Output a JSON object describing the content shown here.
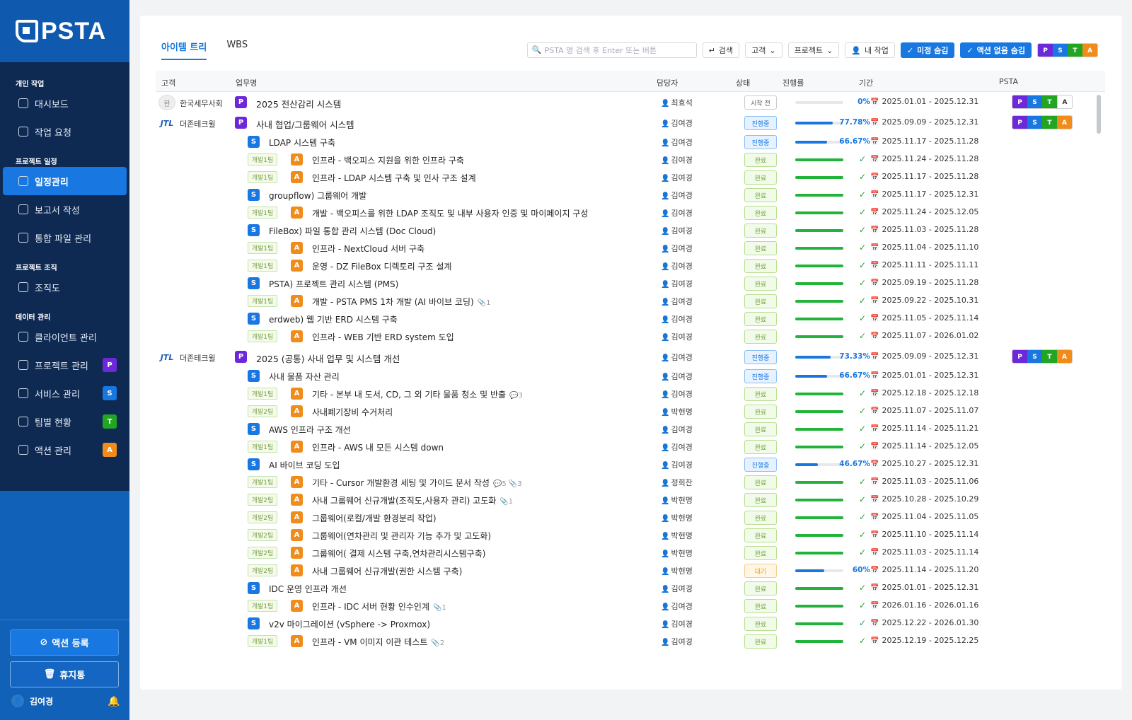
{
  "app": {
    "logo_text": "PSTA"
  },
  "sidebar": {
    "sections": [
      {
        "title": "개인 작업",
        "items": [
          {
            "label": "대시보드",
            "icon": "dashboard-icon"
          },
          {
            "label": "작업 요청",
            "icon": "edit-icon"
          }
        ]
      },
      {
        "title": "프로젝트 일정",
        "items": [
          {
            "label": "일정관리",
            "icon": "calendar-icon",
            "active": true
          },
          {
            "label": "보고서 작성",
            "icon": "document-icon"
          },
          {
            "label": "통합 파일 관리",
            "icon": "file-search-icon"
          }
        ]
      },
      {
        "title": "프로젝트 조직",
        "items": [
          {
            "label": "조직도",
            "icon": "org-chart-icon"
          }
        ]
      },
      {
        "title": "데이터 관리",
        "items": [
          {
            "label": "클라이언트 관리",
            "icon": "building-icon"
          },
          {
            "label": "프로젝트 관리",
            "icon": "folder-icon",
            "badge": "P"
          },
          {
            "label": "서비스 관리",
            "icon": "grid-icon",
            "badge": "S"
          },
          {
            "label": "팀별 현황",
            "icon": "team-icon",
            "badge": "T"
          },
          {
            "label": "액션 관리",
            "icon": "check-circle-icon",
            "badge": "A"
          }
        ]
      }
    ],
    "action_button": "액션 등록",
    "trash_button": "휴지통",
    "user_name": "김여경"
  },
  "colors": {
    "P": "#6d28d9",
    "S": "#1877e0",
    "T": "#22a522",
    "A": "#f08c1b",
    "accent": "#1877e0"
  },
  "tabs": [
    "아이템 트리",
    "WBS"
  ],
  "toolbar": {
    "search_placeholder": "PSTA 명 검색 후 Enter 또는 버튼",
    "search_button": "검색",
    "customer_select": "고객",
    "project_select": "프로젝트",
    "my_work": "내 작업",
    "hide_unfinished": "미정 숨김",
    "hide_no_action": "액션 없음 숨김",
    "psta_letters": [
      "P",
      "S",
      "T",
      "A"
    ]
  },
  "table": {
    "headers": [
      "고객",
      "업무명",
      "담당자",
      "상태",
      "진행률",
      "기간",
      "PSTA"
    ],
    "rows": [
      {
        "level": "P",
        "customer": "한국세무사회",
        "avatar": "한",
        "name": "2025 전산감리 시스템",
        "owner": "최효석",
        "status": "시작 전",
        "progress": 0,
        "progress_text": "0%",
        "period": "2025.01.01 - 2025.12.31",
        "psta": [
          "P",
          "S",
          "T",
          "A"
        ],
        "psta_on": 2
      },
      {
        "level": "P",
        "customer": "더존테크윌",
        "avatar": "JTL",
        "name": "사내 협업/그룹웨어 시스템",
        "owner": "김여경",
        "status": "진행중",
        "progress": 77.78,
        "progress_text": "77.78%",
        "period": "2025.09.09 - 2025.12.31",
        "psta": [
          "P",
          "S",
          "T",
          "A"
        ],
        "psta_on": 3
      },
      {
        "level": "S",
        "name": "LDAP 시스템 구축",
        "owner": "김여경",
        "status": "진행중",
        "progress": 66.67,
        "progress_text": "66.67%",
        "period": "2025.11.17 - 2025.11.28"
      },
      {
        "level": "A",
        "dev": "개발1팀",
        "name": "인프라 - 백오피스 지원을 위한 인프라 구축",
        "owner": "김여경",
        "status": "완료",
        "progress": 100,
        "period": "2025.11.24 - 2025.11.28"
      },
      {
        "level": "A",
        "dev": "개발1팀",
        "name": "인프라 - LDAP 시스템 구축 및 인사 구조 설계",
        "owner": "김여경",
        "status": "완료",
        "progress": 100,
        "period": "2025.11.17 - 2025.11.28"
      },
      {
        "level": "S",
        "name": "groupflow) 그룹웨어 개발",
        "owner": "김여경",
        "status": "완료",
        "progress": 100,
        "period": "2025.11.17 - 2025.12.31"
      },
      {
        "level": "A",
        "dev": "개발1팀",
        "name": "개발 - 백오피스를 위한 LDAP 조직도 및 내부 사용자 인증 및 마이페이지 구성",
        "owner": "김여경",
        "status": "완료",
        "progress": 100,
        "period": "2025.11.24 - 2025.12.05"
      },
      {
        "level": "S",
        "name": "FileBox) 파일 통합 관리 시스템 (Doc Cloud)",
        "owner": "김여경",
        "status": "완료",
        "progress": 100,
        "period": "2025.11.03 - 2025.11.28"
      },
      {
        "level": "A",
        "dev": "개발1팀",
        "name": "인프라 - NextCloud 서버 구축",
        "owner": "김여경",
        "status": "완료",
        "progress": 100,
        "period": "2025.11.04 - 2025.11.10"
      },
      {
        "level": "A",
        "dev": "개발1팀",
        "name": "운영 - DZ FileBox 디렉토리 구조 설계",
        "owner": "김여경",
        "status": "완료",
        "progress": 100,
        "period": "2025.11.11 - 2025.11.11"
      },
      {
        "level": "S",
        "name": "PSTA) 프로젝트 관리 시스템 (PMS)",
        "owner": "김여경",
        "status": "완료",
        "progress": 100,
        "period": "2025.09.19 - 2025.11.28"
      },
      {
        "level": "A",
        "dev": "개발1팀",
        "name": "개발 - PSTA PMS 1차 개발 (AI 바이브 코딩)",
        "attach": "📎1",
        "owner": "김여경",
        "status": "완료",
        "progress": 100,
        "period": "2025.09.22 - 2025.10.31"
      },
      {
        "level": "S",
        "name": "erdweb) 웹 기반 ERD 시스템 구축",
        "owner": "김여경",
        "status": "완료",
        "progress": 100,
        "period": "2025.11.05 - 2025.11.14"
      },
      {
        "level": "A",
        "dev": "개발1팀",
        "name": "인프라 - WEB 기반 ERD system 도입",
        "owner": "김여경",
        "status": "완료",
        "progress": 100,
        "period": "2025.11.07 - 2026.01.02"
      },
      {
        "level": "P",
        "customer": "더존테크윌",
        "avatar": "JTL",
        "name": "2025 (공통) 사내 업무 및 시스템 개선",
        "owner": "김여경",
        "status": "진행중",
        "progress": 73.33,
        "progress_text": "73.33%",
        "period": "2025.09.09 - 2025.12.31",
        "psta": [
          "P",
          "S",
          "T",
          "A"
        ],
        "psta_on": 3
      },
      {
        "level": "S",
        "name": "사내 물품 자산 관리",
        "owner": "김여경",
        "status": "진행중",
        "progress": 66.67,
        "progress_text": "66.67%",
        "period": "2025.01.01 - 2025.12.31"
      },
      {
        "level": "A",
        "dev": "개발1팀",
        "name": "기타 - 본부 내 도서, CD, 그 외 기타 물품 청소 및 반출",
        "attach": "💬3",
        "owner": "김여경",
        "status": "완료",
        "progress": 100,
        "period": "2025.12.18 - 2025.12.18"
      },
      {
        "level": "A",
        "dev": "개발2팀",
        "name": "사내폐기장비 수거처리",
        "owner": "박현명",
        "status": "완료",
        "progress": 100,
        "period": "2025.11.07 - 2025.11.07"
      },
      {
        "level": "S",
        "name": "AWS 인프라 구조 개선",
        "owner": "김여경",
        "status": "완료",
        "progress": 100,
        "period": "2025.11.14 - 2025.11.21"
      },
      {
        "level": "A",
        "dev": "개발1팀",
        "name": "인프라 - AWS 내 모든 시스템 down",
        "owner": "김여경",
        "status": "완료",
        "progress": 100,
        "period": "2025.11.14 - 2025.12.05"
      },
      {
        "level": "S",
        "name": "AI 바이브 코딩 도입",
        "owner": "김여경",
        "status": "진행중",
        "progress": 46.67,
        "progress_text": "46.67%",
        "period": "2025.10.27 - 2025.12.31"
      },
      {
        "level": "A",
        "dev": "개발1팀",
        "name": "기타 - Cursor 개발환경 세팅 및 가이드 문서 작성",
        "attach": "💬5 📎3",
        "owner": "정희찬",
        "status": "완료",
        "progress": 100,
        "period": "2025.11.03 - 2025.11.06"
      },
      {
        "level": "A",
        "dev": "개발2팀",
        "name": "사내 그룹웨어 신규개발(조직도,사용자 관리) 고도화",
        "attach": "📎1",
        "owner": "박현명",
        "status": "완료",
        "progress": 100,
        "period": "2025.10.28 - 2025.10.29"
      },
      {
        "level": "A",
        "dev": "개발2팀",
        "name": "그룹웨어(로컬/개발 환경분리 작업)",
        "owner": "박현명",
        "status": "완료",
        "progress": 100,
        "period": "2025.11.04 - 2025.11.05"
      },
      {
        "level": "A",
        "dev": "개발2팀",
        "name": "그룹웨어(연차관리 및 관리자 기능 추가 및 고도화)",
        "owner": "박현명",
        "status": "완료",
        "progress": 100,
        "period": "2025.11.10 - 2025.11.14"
      },
      {
        "level": "A",
        "dev": "개발2팀",
        "name": "그룹웨어( 결제 시스템 구축,연차관리시스템구축)",
        "owner": "박현명",
        "status": "완료",
        "progress": 100,
        "period": "2025.11.03 - 2025.11.14"
      },
      {
        "level": "A",
        "dev": "개발2팀",
        "name": "사내 그룹웨어 신규개발(권한 시스템 구축)",
        "owner": "박현명",
        "status": "대기",
        "progress": 60,
        "progress_text": "60%",
        "period": "2025.11.14 - 2025.11.20"
      },
      {
        "level": "S",
        "name": "IDC 운영 인프라 개선",
        "owner": "김여경",
        "status": "완료",
        "progress": 100,
        "period": "2025.01.01 - 2025.12.31"
      },
      {
        "level": "A",
        "dev": "개발1팀",
        "name": "인프라 - IDC 서버 현황 인수인계",
        "attach": "📎1",
        "owner": "김여경",
        "status": "완료",
        "progress": 100,
        "period": "2026.01.16 - 2026.01.16"
      },
      {
        "level": "S",
        "name": "v2v 마이그레이션 (vSphere -> Proxmox)",
        "owner": "김여경",
        "status": "완료",
        "progress": 100,
        "period": "2025.12.22 - 2026.01.30"
      },
      {
        "level": "A",
        "dev": "개발1팀",
        "name": "인프라 - VM 이미지 이관 테스트",
        "attach": "📎2",
        "owner": "김여경",
        "status": "완료",
        "progress": 100,
        "period": "2025.12.19 - 2025.12.25"
      }
    ]
  }
}
